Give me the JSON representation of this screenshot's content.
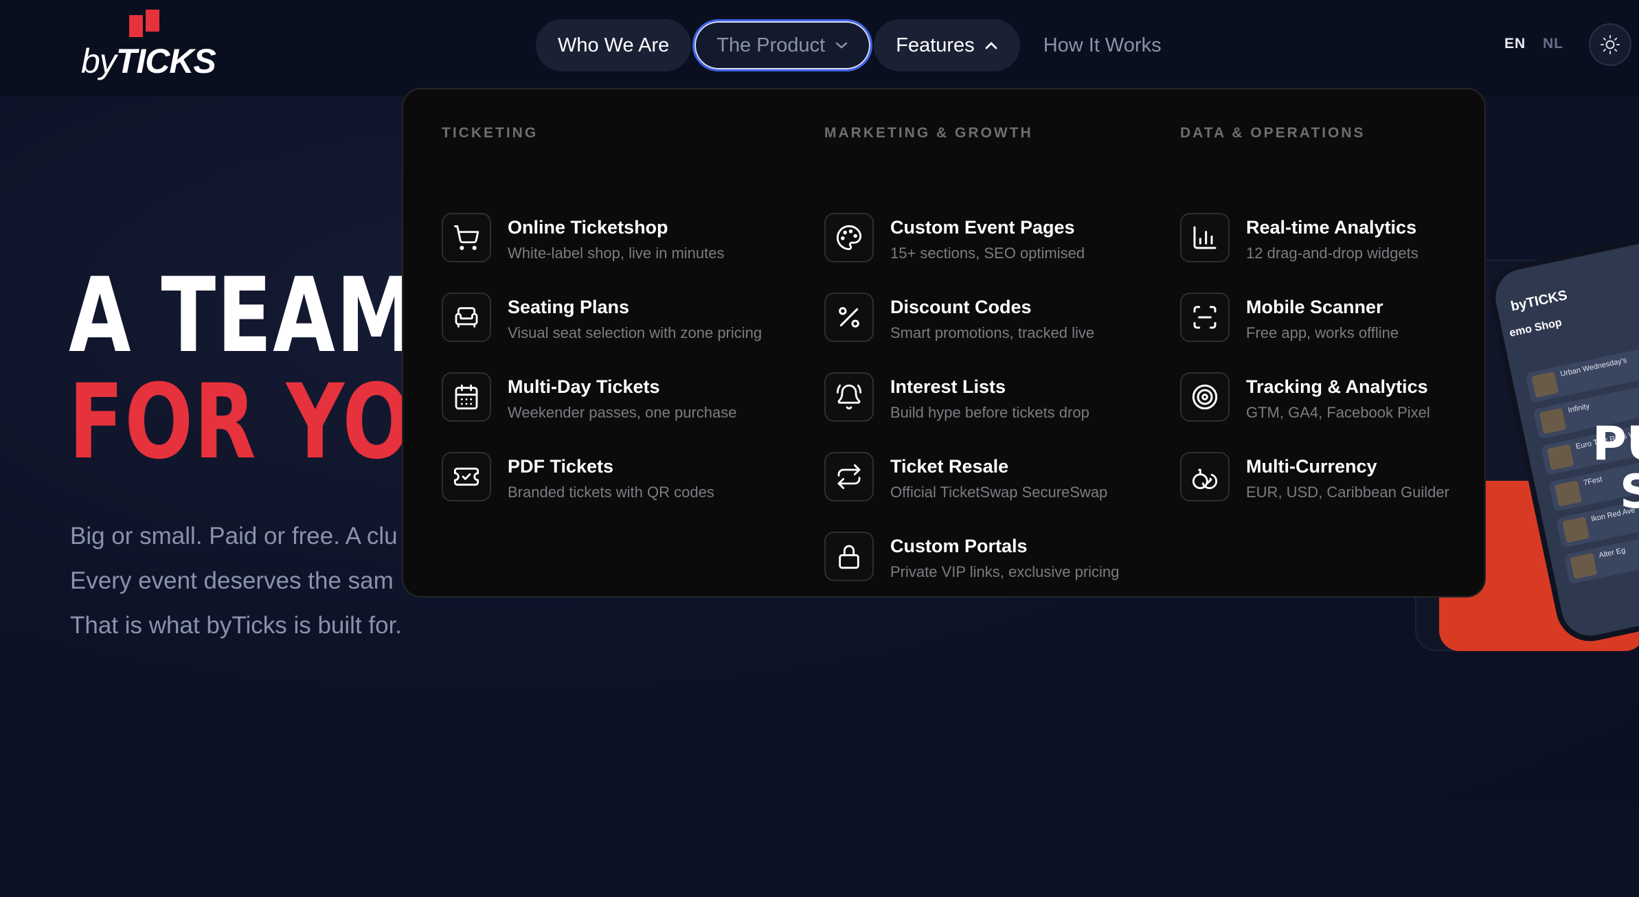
{
  "brand": {
    "logo_by": "by",
    "logo_ticks": "TICKS",
    "accent": "#e6323c"
  },
  "nav": {
    "who_we_are": "Who We Are",
    "the_product": "The Product",
    "features": "Features",
    "how_it_works": "How It Works"
  },
  "lang": {
    "en": "EN",
    "nl": "NL",
    "active": "EN"
  },
  "theme_toggle_icon": "sun-icon",
  "hero": {
    "line1": "A TEAM W",
    "line2": "FOR YOUR",
    "body": [
      "Big or small. Paid or free. A clu",
      "Every event deserves the sam",
      "That is what byTicks is built for."
    ]
  },
  "phone": {
    "brand": "byTICKS",
    "shop": "emo Shop",
    "rows": [
      "Urban Wednesday's",
      "Infinity",
      "Euro Tour Russ W",
      "7Fest",
      "Ikon Red Ave",
      "Alter Eg"
    ],
    "big_text": [
      "PU",
      "S"
    ]
  },
  "dropdown": {
    "columns": [
      {
        "heading": "TICKETING",
        "items": [
          {
            "title": "Online Ticketshop",
            "desc": "White-label shop, live in minutes",
            "icon": "cart-icon"
          },
          {
            "title": "Seating Plans",
            "desc": "Visual seat selection with zone pricing",
            "icon": "armchair-icon"
          },
          {
            "title": "Multi-Day Tickets",
            "desc": "Weekender passes, one purchase",
            "icon": "calendar-icon"
          },
          {
            "title": "PDF Tickets",
            "desc": "Branded tickets with QR codes",
            "icon": "ticket-icon"
          }
        ]
      },
      {
        "heading": "MARKETING & GROWTH",
        "items": [
          {
            "title": "Custom Event Pages",
            "desc": "15+ sections, SEO optimised",
            "icon": "palette-icon"
          },
          {
            "title": "Discount Codes",
            "desc": "Smart promotions, tracked live",
            "icon": "percent-icon"
          },
          {
            "title": "Interest Lists",
            "desc": "Build hype before tickets drop",
            "icon": "bell-icon"
          },
          {
            "title": "Ticket Resale",
            "desc": "Official TicketSwap SecureSwap",
            "icon": "swap-icon"
          },
          {
            "title": "Custom Portals",
            "desc": "Private VIP links, exclusive pricing",
            "icon": "lock-icon"
          }
        ]
      },
      {
        "heading": "DATA & OPERATIONS",
        "items": [
          {
            "title": "Real-time Analytics",
            "desc": "12 drag-and-drop widgets",
            "icon": "bar-chart-icon"
          },
          {
            "title": "Mobile Scanner",
            "desc": "Free app, works offline",
            "icon": "scan-icon"
          },
          {
            "title": "Tracking & Analytics",
            "desc": "GTM, GA4, Facebook Pixel",
            "icon": "target-icon"
          },
          {
            "title": "Multi-Currency",
            "desc": "EUR, USD, Caribbean Guilder",
            "icon": "coins-icon"
          }
        ]
      }
    ]
  }
}
